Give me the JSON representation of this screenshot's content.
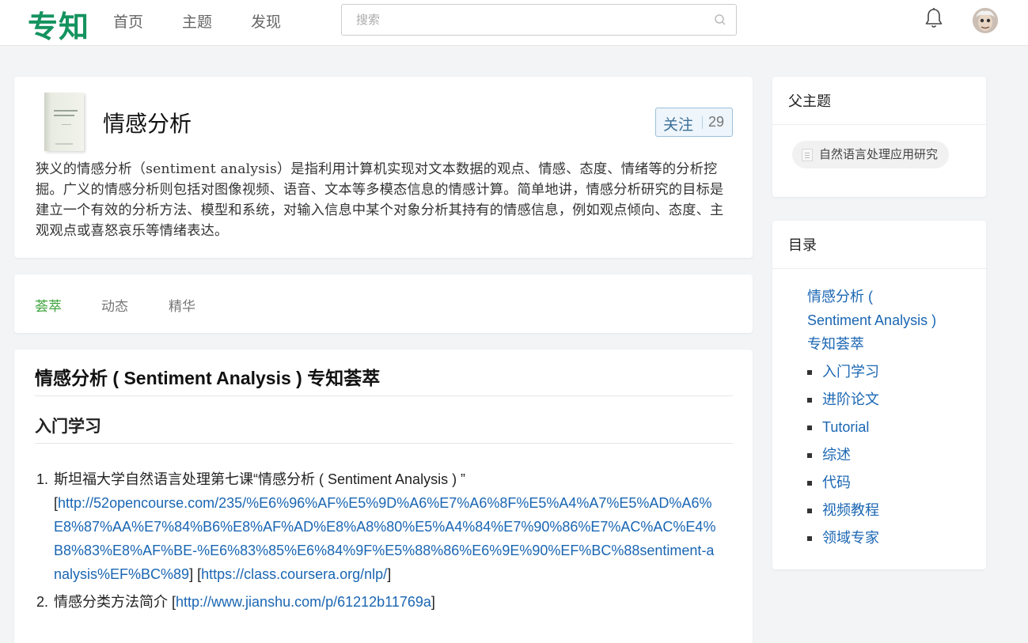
{
  "header": {
    "logo": "专知",
    "nav": [
      "首页",
      "主题",
      "发现"
    ],
    "search_placeholder": "搜索",
    "icons": [
      "search-icon",
      "bell-icon",
      "avatar"
    ]
  },
  "topic": {
    "title": "情感分析",
    "follow_label": "关注",
    "follow_count": "29",
    "description": "狭义的情感分析（sentiment analysis）是指利用计算机实现对文本数据的观点、情感、态度、情绪等的分析挖掘。广义的情感分析则包括对图像视频、语音、文本等多模态信息的情感计算。简单地讲，情感分析研究的目标是建立一个有效的分析方法、模型和系统，对输入信息中某个对象分析其持有的情感信息，例如观点倾向、态度、主观观点或喜怒哀乐等情绪表达。"
  },
  "tabs": [
    "荟萃",
    "动态",
    "精华"
  ],
  "article": {
    "h1": "情感分析 ( Sentiment Analysis ) 专知荟萃",
    "h2": "入门学习",
    "items": [
      {
        "num": "1.",
        "text": "斯坦福大学自然语言处理第七课“情感分析 ( Sentiment Analysis ) ”",
        "open_bracket": "[",
        "link1": "http://52opencourse.com/235/%E6%96%AF%E5%9D%A6%E7%A6%8F%E5%A4%A7%E5%AD%A6%E8%87%AA%E7%84%B6%E8%AF%AD%E8%A8%80%E5%A4%84%E7%90%86%E7%AC%AC%E4%B8%83%E8%AF%BE-%E6%83%85%E6%84%9F%E5%88%86%E6%9E%90%EF%BC%88sentiment-analysis%EF%BC%89",
        "between": "] [",
        "link2": "https://class.coursera.org/nlp/",
        "close_bracket": "]"
      },
      {
        "num": "2.",
        "text": "情感分类方法简介",
        "open_bracket": " [",
        "link1": "http://www.jianshu.com/p/61212b11769a",
        "close_bracket": "]"
      }
    ]
  },
  "sidebar": {
    "parent_title": "父主题",
    "parent_chip": "自然语言处理应用研究",
    "toc_title": "目录",
    "toc_main": [
      "情感分析 (",
      "Sentiment Analysis )",
      "专知荟萃"
    ],
    "toc_items": [
      "入门学习",
      "进阶论文",
      "Tutorial",
      "综述",
      "代码",
      "视频教程",
      "领域专家"
    ]
  }
}
